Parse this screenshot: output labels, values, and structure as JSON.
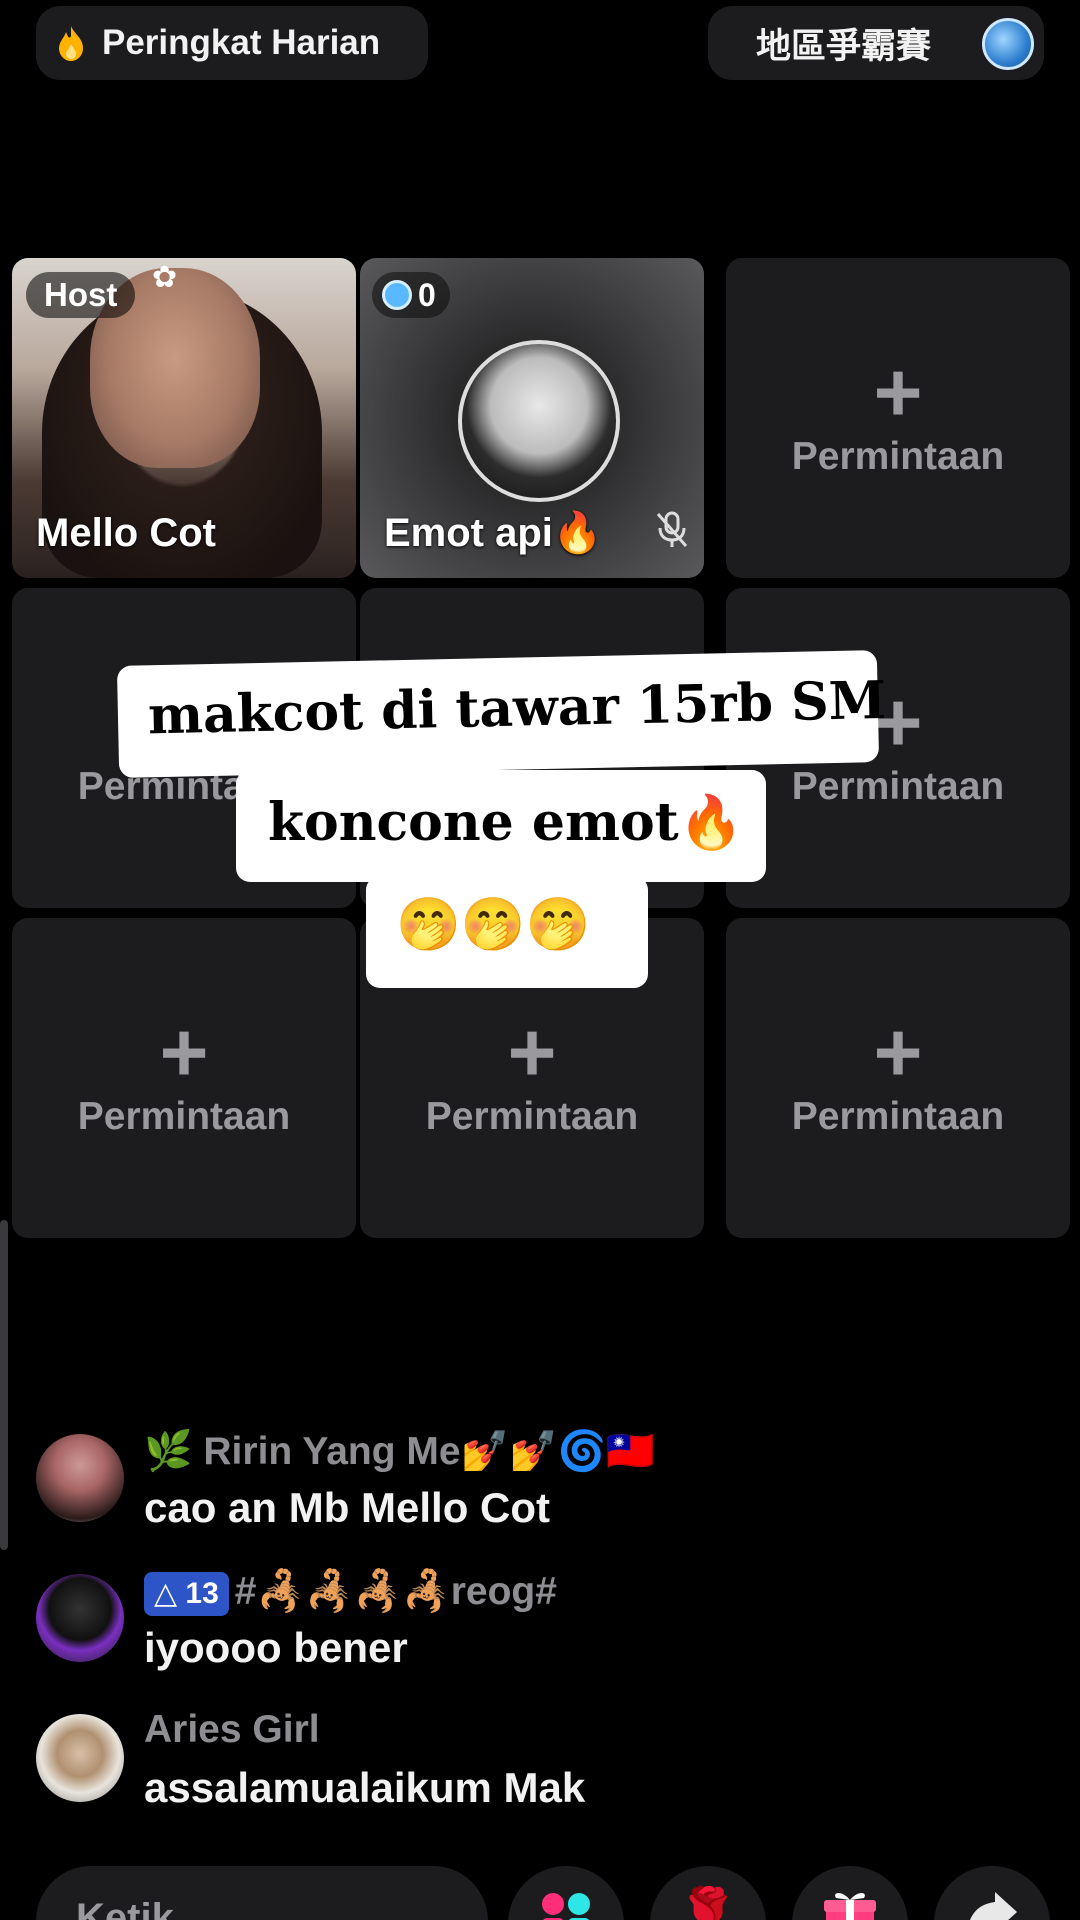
{
  "top_bar": {
    "daily_ranking_label": "Peringkat Harian",
    "region_label": "地區爭霸賽"
  },
  "seats": {
    "host": {
      "badge": "Host",
      "name": "Mello Cot"
    },
    "guest": {
      "coin_count": "0",
      "name": "Emot api🔥"
    },
    "empty_label": "Permintaan",
    "plus": "+"
  },
  "overlay_caption": {
    "line1": "makcot di tawar 15rb SM",
    "line2": "koncone emot🔥",
    "line3": "🤭🤭🤭"
  },
  "chat": [
    {
      "user": "🌿 Ririn Yang Me💅💅🌀🇹🇼",
      "text": "cao an Mb Mello Cot"
    },
    {
      "level": "△ 13",
      "user": "#🦂🦂🦂🦂reog#",
      "text": "iyoooo bener"
    },
    {
      "user": "Aries Girl",
      "text": "assalamualaikum Mak"
    }
  ],
  "bottom_bar": {
    "input_placeholder": "Ketik",
    "rose_icon": "🌹"
  },
  "colors": {
    "background": "#000000",
    "tile": "#1c1c1e",
    "muted_text": "#9a9a9e",
    "level_badge": "#2d55c8"
  }
}
